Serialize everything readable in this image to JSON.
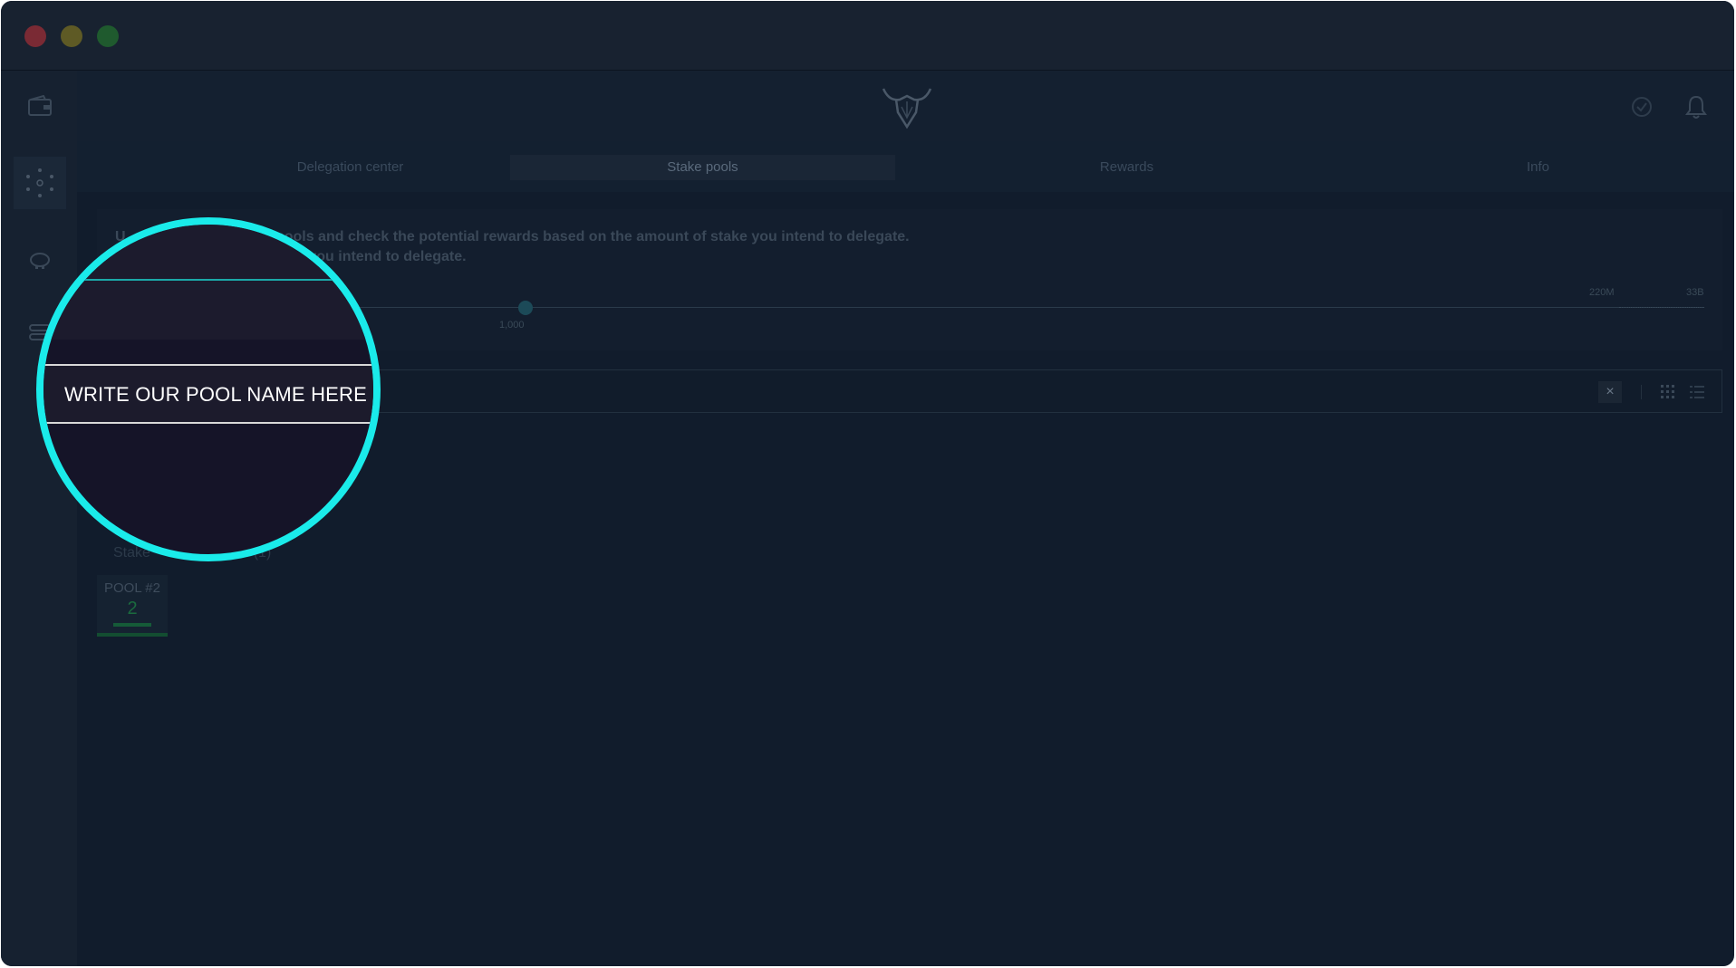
{
  "window": {
    "controls": [
      "close",
      "minimize",
      "maximize"
    ]
  },
  "sidebar": {
    "items": [
      {
        "icon": "wallet-icon"
      },
      {
        "icon": "stake-pools-dots-icon",
        "active": true
      },
      {
        "icon": "piggy-bank-icon"
      },
      {
        "icon": "settings-toggle-icon"
      }
    ]
  },
  "header": {
    "logo": "bull-logo",
    "right_icons": [
      "sync-check-icon",
      "bell-icon"
    ]
  },
  "tabs": [
    {
      "label": "Delegation center",
      "active": false
    },
    {
      "label": "Stake pools",
      "active": true
    },
    {
      "label": "Rewards",
      "active": false
    },
    {
      "label": "Info",
      "active": false
    }
  ],
  "info": {
    "line1": "U                             take pools and check the potential rewards based on the amount of stake you intend to delegate.",
    "line2": "                                  amount you intend to delegate.",
    "slider": {
      "value_label": "1,000",
      "ticks": [
        "220M",
        "33B"
      ]
    }
  },
  "search": {
    "value": "WRITE OUR POOL NAME HERE",
    "clear_label": "×",
    "view_icons": [
      "grid-view-icon",
      "list-view-icon"
    ]
  },
  "results": {
    "label": "Stake                    lts: (1)"
  },
  "pools": [
    {
      "name": "POOL #2",
      "rank": "2"
    }
  ],
  "colors": {
    "background": "#111c2c",
    "accent": "#1aebea",
    "rank": "#1a6a3e"
  }
}
